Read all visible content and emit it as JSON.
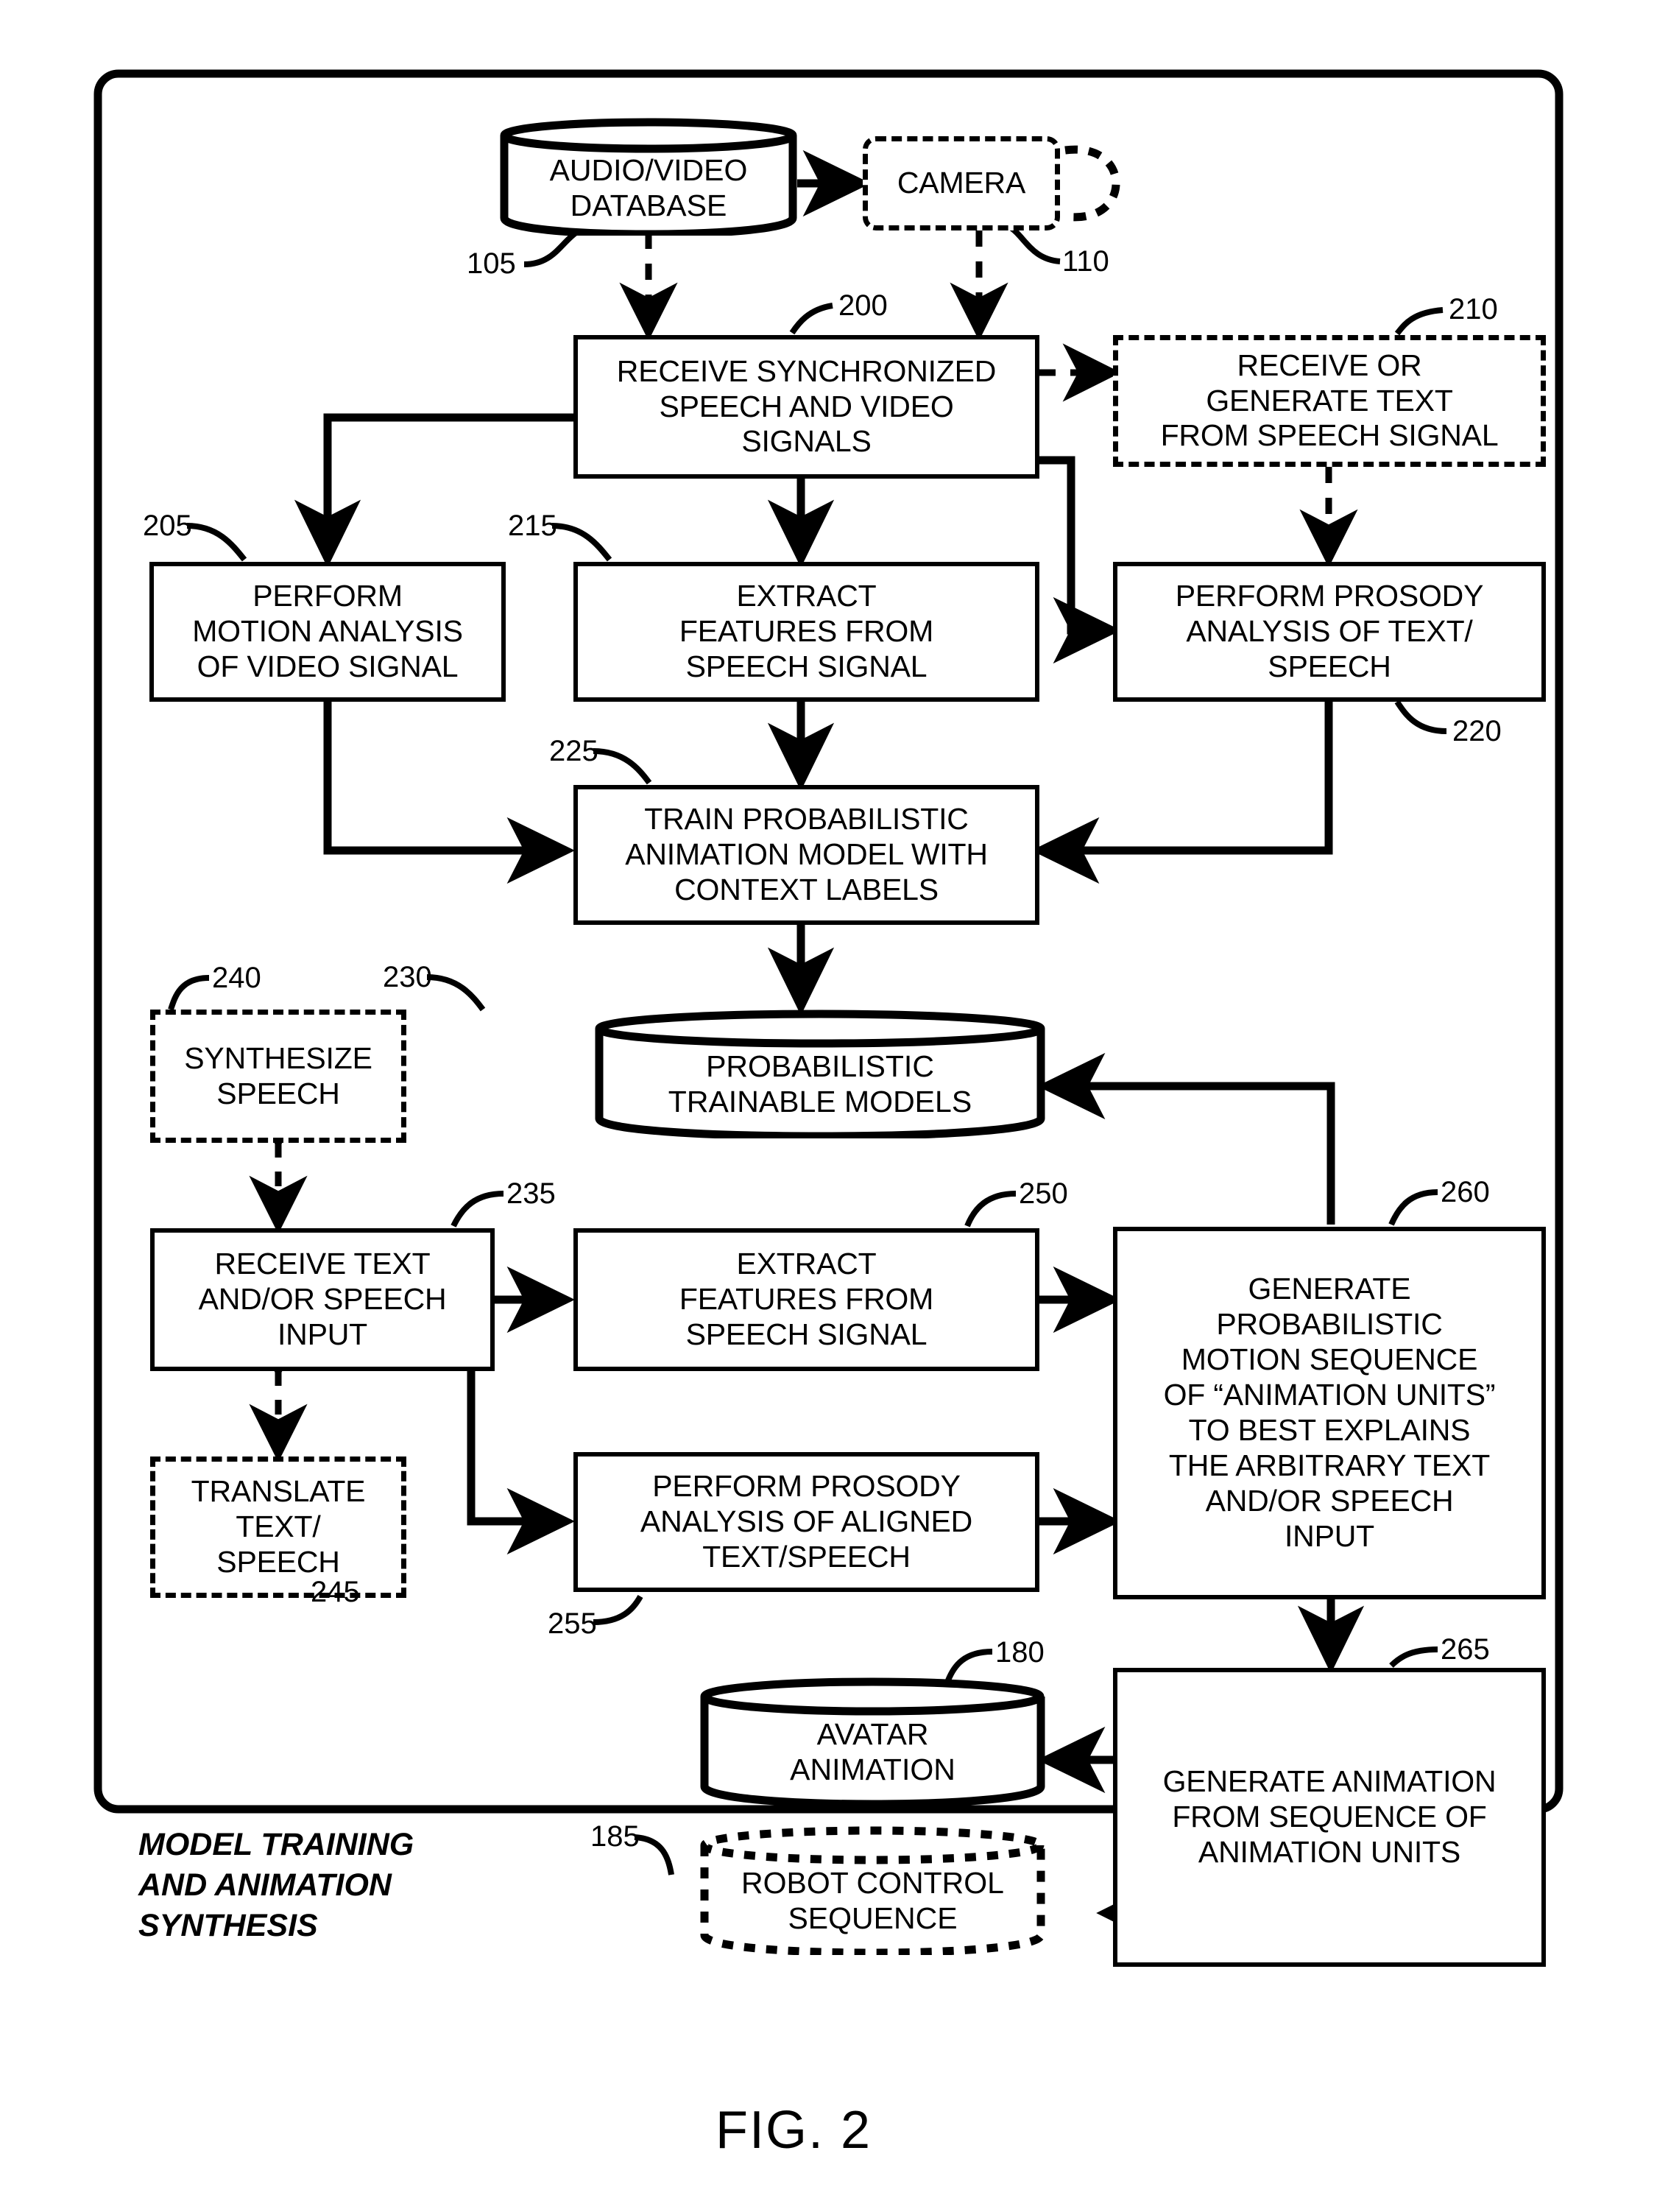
{
  "figure": {
    "label": "FIG. 2",
    "panel_caption": "MODEL TRAINING\nAND ANIMATION\nSYNTHESIS"
  },
  "nodes": {
    "audio_video_database": {
      "ref": "105",
      "label": "AUDIO/VIDEO\nDATABASE",
      "shape": "cylinder",
      "style": "solid"
    },
    "camera": {
      "ref": "110",
      "label": "CAMERA",
      "shape": "rounded-rect",
      "style": "dashed"
    },
    "receive_sync_signals": {
      "ref": "200",
      "label": "RECEIVE SYNCHRONIZED\nSPEECH AND VIDEO\nSIGNALS",
      "shape": "rect",
      "style": "solid"
    },
    "receive_or_generate_text": {
      "ref": "210",
      "label": "RECEIVE OR\nGENERATE TEXT\nFROM SPEECH SIGNAL",
      "shape": "rect",
      "style": "dashed"
    },
    "perform_motion_analysis": {
      "ref": "205",
      "label": "PERFORM\nMOTION ANALYSIS\nOF VIDEO SIGNAL",
      "shape": "rect",
      "style": "solid"
    },
    "extract_features_train": {
      "ref": "215",
      "label": "EXTRACT\nFEATURES FROM\nSPEECH SIGNAL",
      "shape": "rect",
      "style": "solid"
    },
    "perform_prosody_text_speech": {
      "ref": "220",
      "label": "PERFORM PROSODY\nANALYSIS OF TEXT/\nSPEECH",
      "shape": "rect",
      "style": "solid"
    },
    "train_probabilistic_model": {
      "ref": "225",
      "label": "TRAIN PROBABILISTIC\nANIMATION MODEL WITH\nCONTEXT LABELS",
      "shape": "rect",
      "style": "solid"
    },
    "probabilistic_trainable_models": {
      "ref": "230",
      "label": "PROBABILISTIC\nTRAINABLE MODELS",
      "shape": "cylinder",
      "style": "solid"
    },
    "synthesize_speech": {
      "ref": "240",
      "label": "SYNTHESIZE\nSPEECH",
      "shape": "rect",
      "style": "dashed"
    },
    "receive_text_speech_input": {
      "ref": "235",
      "label": "RECEIVE TEXT\nAND/OR SPEECH\nINPUT",
      "shape": "rect",
      "style": "solid"
    },
    "translate_text_speech": {
      "ref": "245",
      "label": "TRANSLATE\nTEXT/\nSPEECH",
      "shape": "rect",
      "style": "dashed"
    },
    "extract_features_synth": {
      "ref": "250",
      "label": "EXTRACT\nFEATURES FROM\nSPEECH SIGNAL",
      "shape": "rect",
      "style": "solid"
    },
    "perform_prosody_aligned": {
      "ref": "255",
      "label": "PERFORM PROSODY\nANALYSIS OF ALIGNED\nTEXT/SPEECH",
      "shape": "rect",
      "style": "solid"
    },
    "generate_motion_sequence": {
      "ref": "260",
      "label": "GENERATE\nPROBABILISTIC\nMOTION SEQUENCE\nOF “ANIMATION UNITS”\nTO BEST EXPLAINS\nTHE ARBITRARY TEXT\nAND/OR SPEECH\nINPUT",
      "shape": "rect",
      "style": "solid"
    },
    "avatar_animation": {
      "ref": "180",
      "label": "AVATAR\nANIMATION",
      "shape": "cylinder",
      "style": "solid"
    },
    "robot_control_sequence": {
      "ref": "185",
      "label": "ROBOT CONTROL\nSEQUENCE",
      "shape": "cylinder",
      "style": "dashed"
    },
    "generate_animation": {
      "ref": "265",
      "label": "GENERATE ANIMATION\nFROM SEQUENCE OF\nANIMATION UNITS",
      "shape": "rect",
      "style": "solid"
    }
  },
  "colors": {
    "stroke": "#000000",
    "fill": "#ffffff"
  }
}
